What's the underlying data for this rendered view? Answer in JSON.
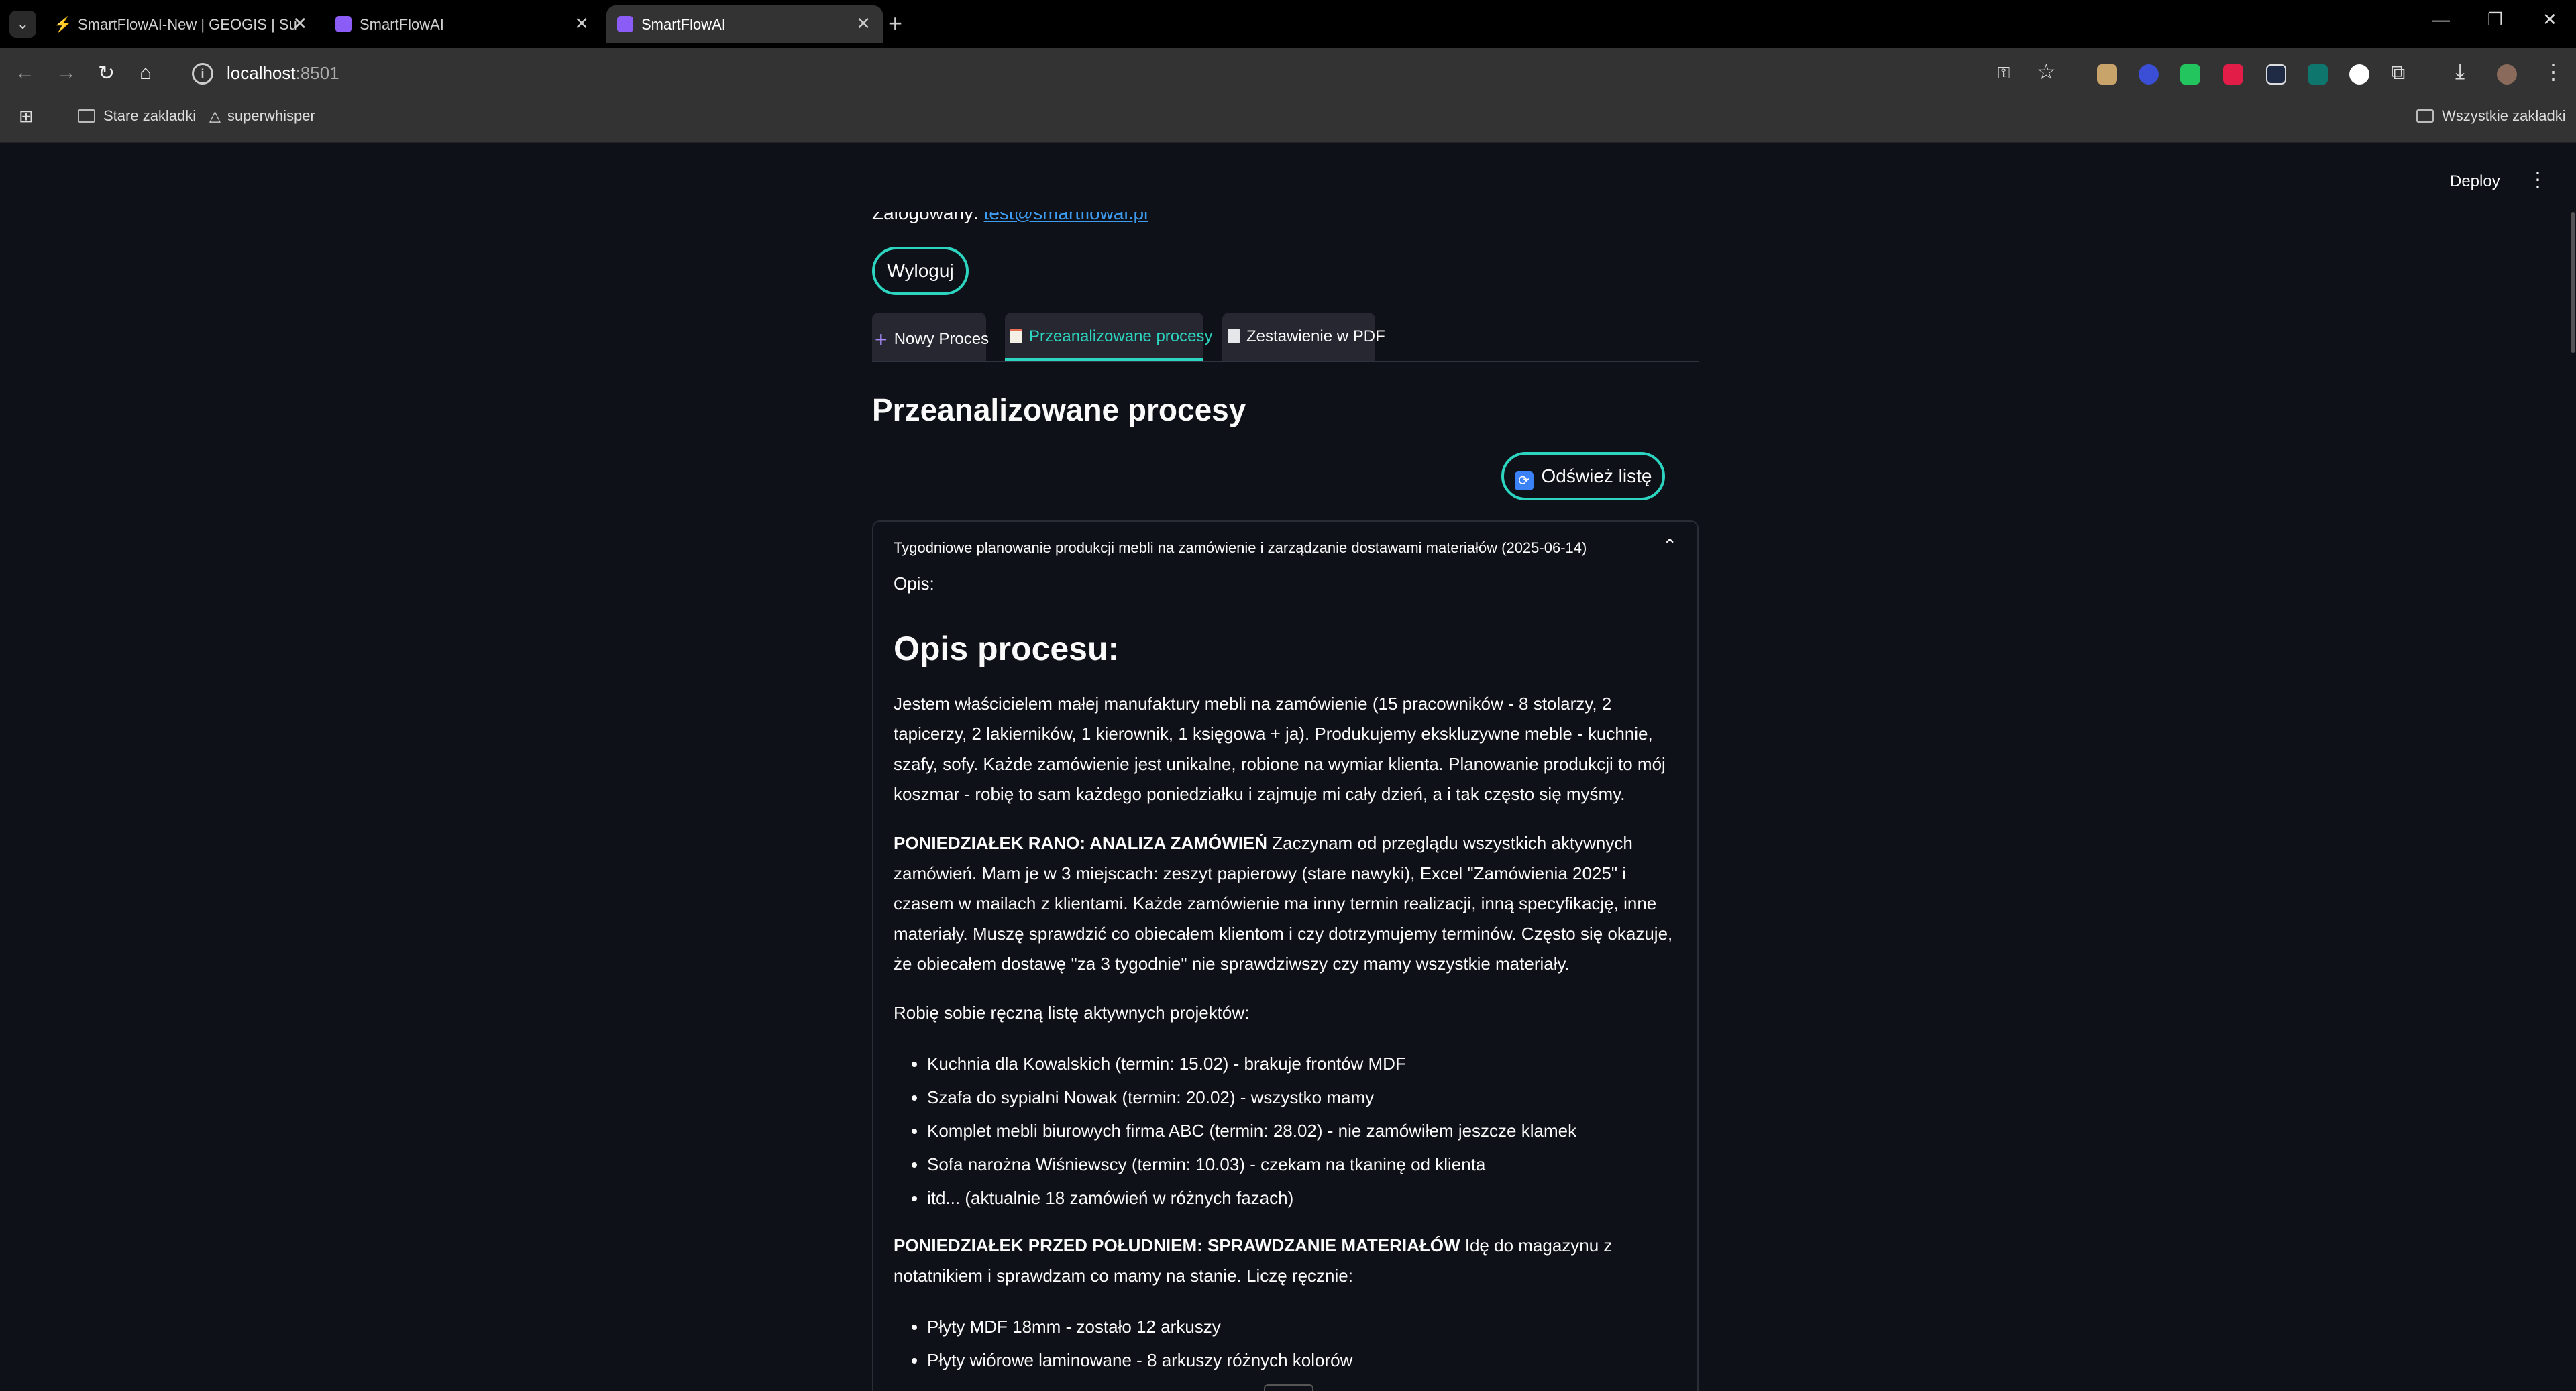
{
  "browser": {
    "tabs": [
      {
        "title": "SmartFlowAI-New | GEOGIS | Su"
      },
      {
        "title": "SmartFlowAI"
      },
      {
        "title": "SmartFlowAI"
      }
    ],
    "url_host": "localhost",
    "url_port": ":8501",
    "bookmarks": [
      {
        "label": "Stare zakladki"
      },
      {
        "label": "superwhisper"
      },
      {
        "label": "Wszystkie zakładki"
      }
    ]
  },
  "header": {
    "deploy_label": "Deploy"
  },
  "main": {
    "logged_label": "Zalogowany:",
    "logged_email": "test@smartflowai.pl",
    "logout_label": "Wyloguj",
    "tabs": [
      {
        "label": "Nowy Proces",
        "icon": "plus-icon"
      },
      {
        "label": "Przeanalizowane procesy",
        "icon": "clipboard-icon"
      },
      {
        "label": "Zestawienie w PDF",
        "icon": "document-icon"
      }
    ],
    "title": "Przeanalizowane procesy",
    "refresh_label": "Odśwież listę",
    "expander": {
      "title": "Tygodniowe planowanie produkcji mebli na zamówienie i zarządzanie dostawami materiałów (2025-06-14)",
      "opis_label": "Opis:",
      "heading": "Opis procesu:",
      "para1": "Jestem właścicielem małej manufaktury mebli na zamówienie (15 pracowników - 8 stolarzy, 2 tapicerzy, 2 lakierników, 1 kierownik, 1 księgowa + ja). Produkujemy ekskluzywne meble - kuchnie, szafy, sofy. Każde zamówienie jest unikalne, robione na wymiar klienta. Planowanie produkcji to mój koszmar - robię to sam każdego poniedziałku i zajmuje mi cały dzień, a i tak często się myśmy.",
      "section1_bold": "PONIEDZIAŁEK RANO: ANALIZA ZAMÓWIEŃ",
      "section1_text": " Zaczynam od przeglądu wszystkich aktywnych zamówień. Mam je w 3 miejscach: zeszyt papierowy (stare nawyki), Excel \"Zamówienia 2025\" i czasem w mailach z klientami. Każde zamówienie ma inny termin realizacji, inną specyfikację, inne materiały. Muszę sprawdzić co obiecałem klientom i czy dotrzymujemy terminów. Często się okazuje, że obiecałem dostawę \"za 3 tygodnie\" nie sprawdziwszy czy mamy wszystkie materiały.",
      "list1_intro": "Robię sobie ręczną listę aktywnych projektów:",
      "list1": [
        "Kuchnia dla Kowalskich (termin: 15.02) - brakuje frontów MDF",
        "Szafa do sypialni Nowak (termin: 20.02) - wszystko mamy",
        "Komplet mebli biurowych firma ABC (termin: 28.02) - nie zamówiłem jeszcze klamek",
        "Sofa narożna Wiśniewscy (termin: 10.03) - czekam na tkaninę od klienta",
        "itd... (aktualnie 18 zamówień w różnych fazach)"
      ],
      "section2_bold": "PONIEDZIAŁEK PRZED POŁUDNIEM: SPRAWDZANIE MATERIAŁÓW",
      "section2_text": " Idę do magazynu z notatnikiem i sprawdzam co mamy na stanie. Liczę ręcznie:",
      "list2": [
        "Płyty MDF 18mm - zostało 12 arkuszy",
        "Płyty wiórowe laminowane - 8 arkuszy różnych kolorów"
      ]
    }
  },
  "colors": {
    "background": "#0e1117",
    "accent": "#2dd4bf",
    "link": "#3d9df3"
  }
}
